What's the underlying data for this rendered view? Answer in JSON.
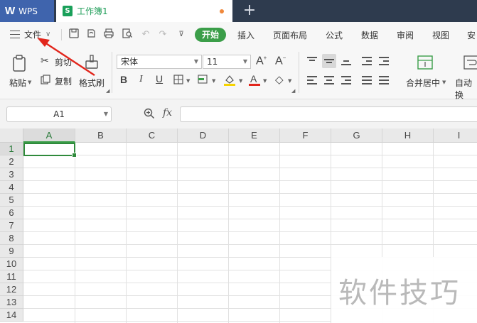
{
  "titlebar": {
    "app_label": "WPS",
    "doc_tab_label": "工作簿1",
    "sheet_icon_glyph": "S",
    "new_tab_glyph": "+"
  },
  "menubar": {
    "file_label": "文件",
    "start_label": "开始",
    "items": [
      "插入",
      "页面布局",
      "公式",
      "数据",
      "审阅",
      "视图",
      "安"
    ]
  },
  "ribbon": {
    "paste_label": "粘贴",
    "cut_label": "剪切",
    "copy_label": "复制",
    "format_painter_label": "格式刷",
    "font_name": "宋体",
    "font_size": "11",
    "merge_center_label": "合并居中",
    "auto_wrap_label": "自动换"
  },
  "formulabar": {
    "cell_ref": "A1",
    "fx_label": "fx",
    "formula_value": ""
  },
  "grid": {
    "columns": [
      "A",
      "B",
      "C",
      "D",
      "E",
      "F",
      "G",
      "H",
      "I"
    ],
    "rows": [
      "1",
      "2",
      "3",
      "4",
      "5",
      "6",
      "7",
      "8",
      "9",
      "10",
      "11",
      "12",
      "13",
      "14"
    ],
    "active_cell": "A1"
  },
  "watermark": "软件技巧",
  "colors": {
    "accent_green": "#3b9e49",
    "wps_blue": "#3f64ad",
    "titlebar_dark": "#2e3b4e",
    "annotation_red": "#e2261c"
  }
}
